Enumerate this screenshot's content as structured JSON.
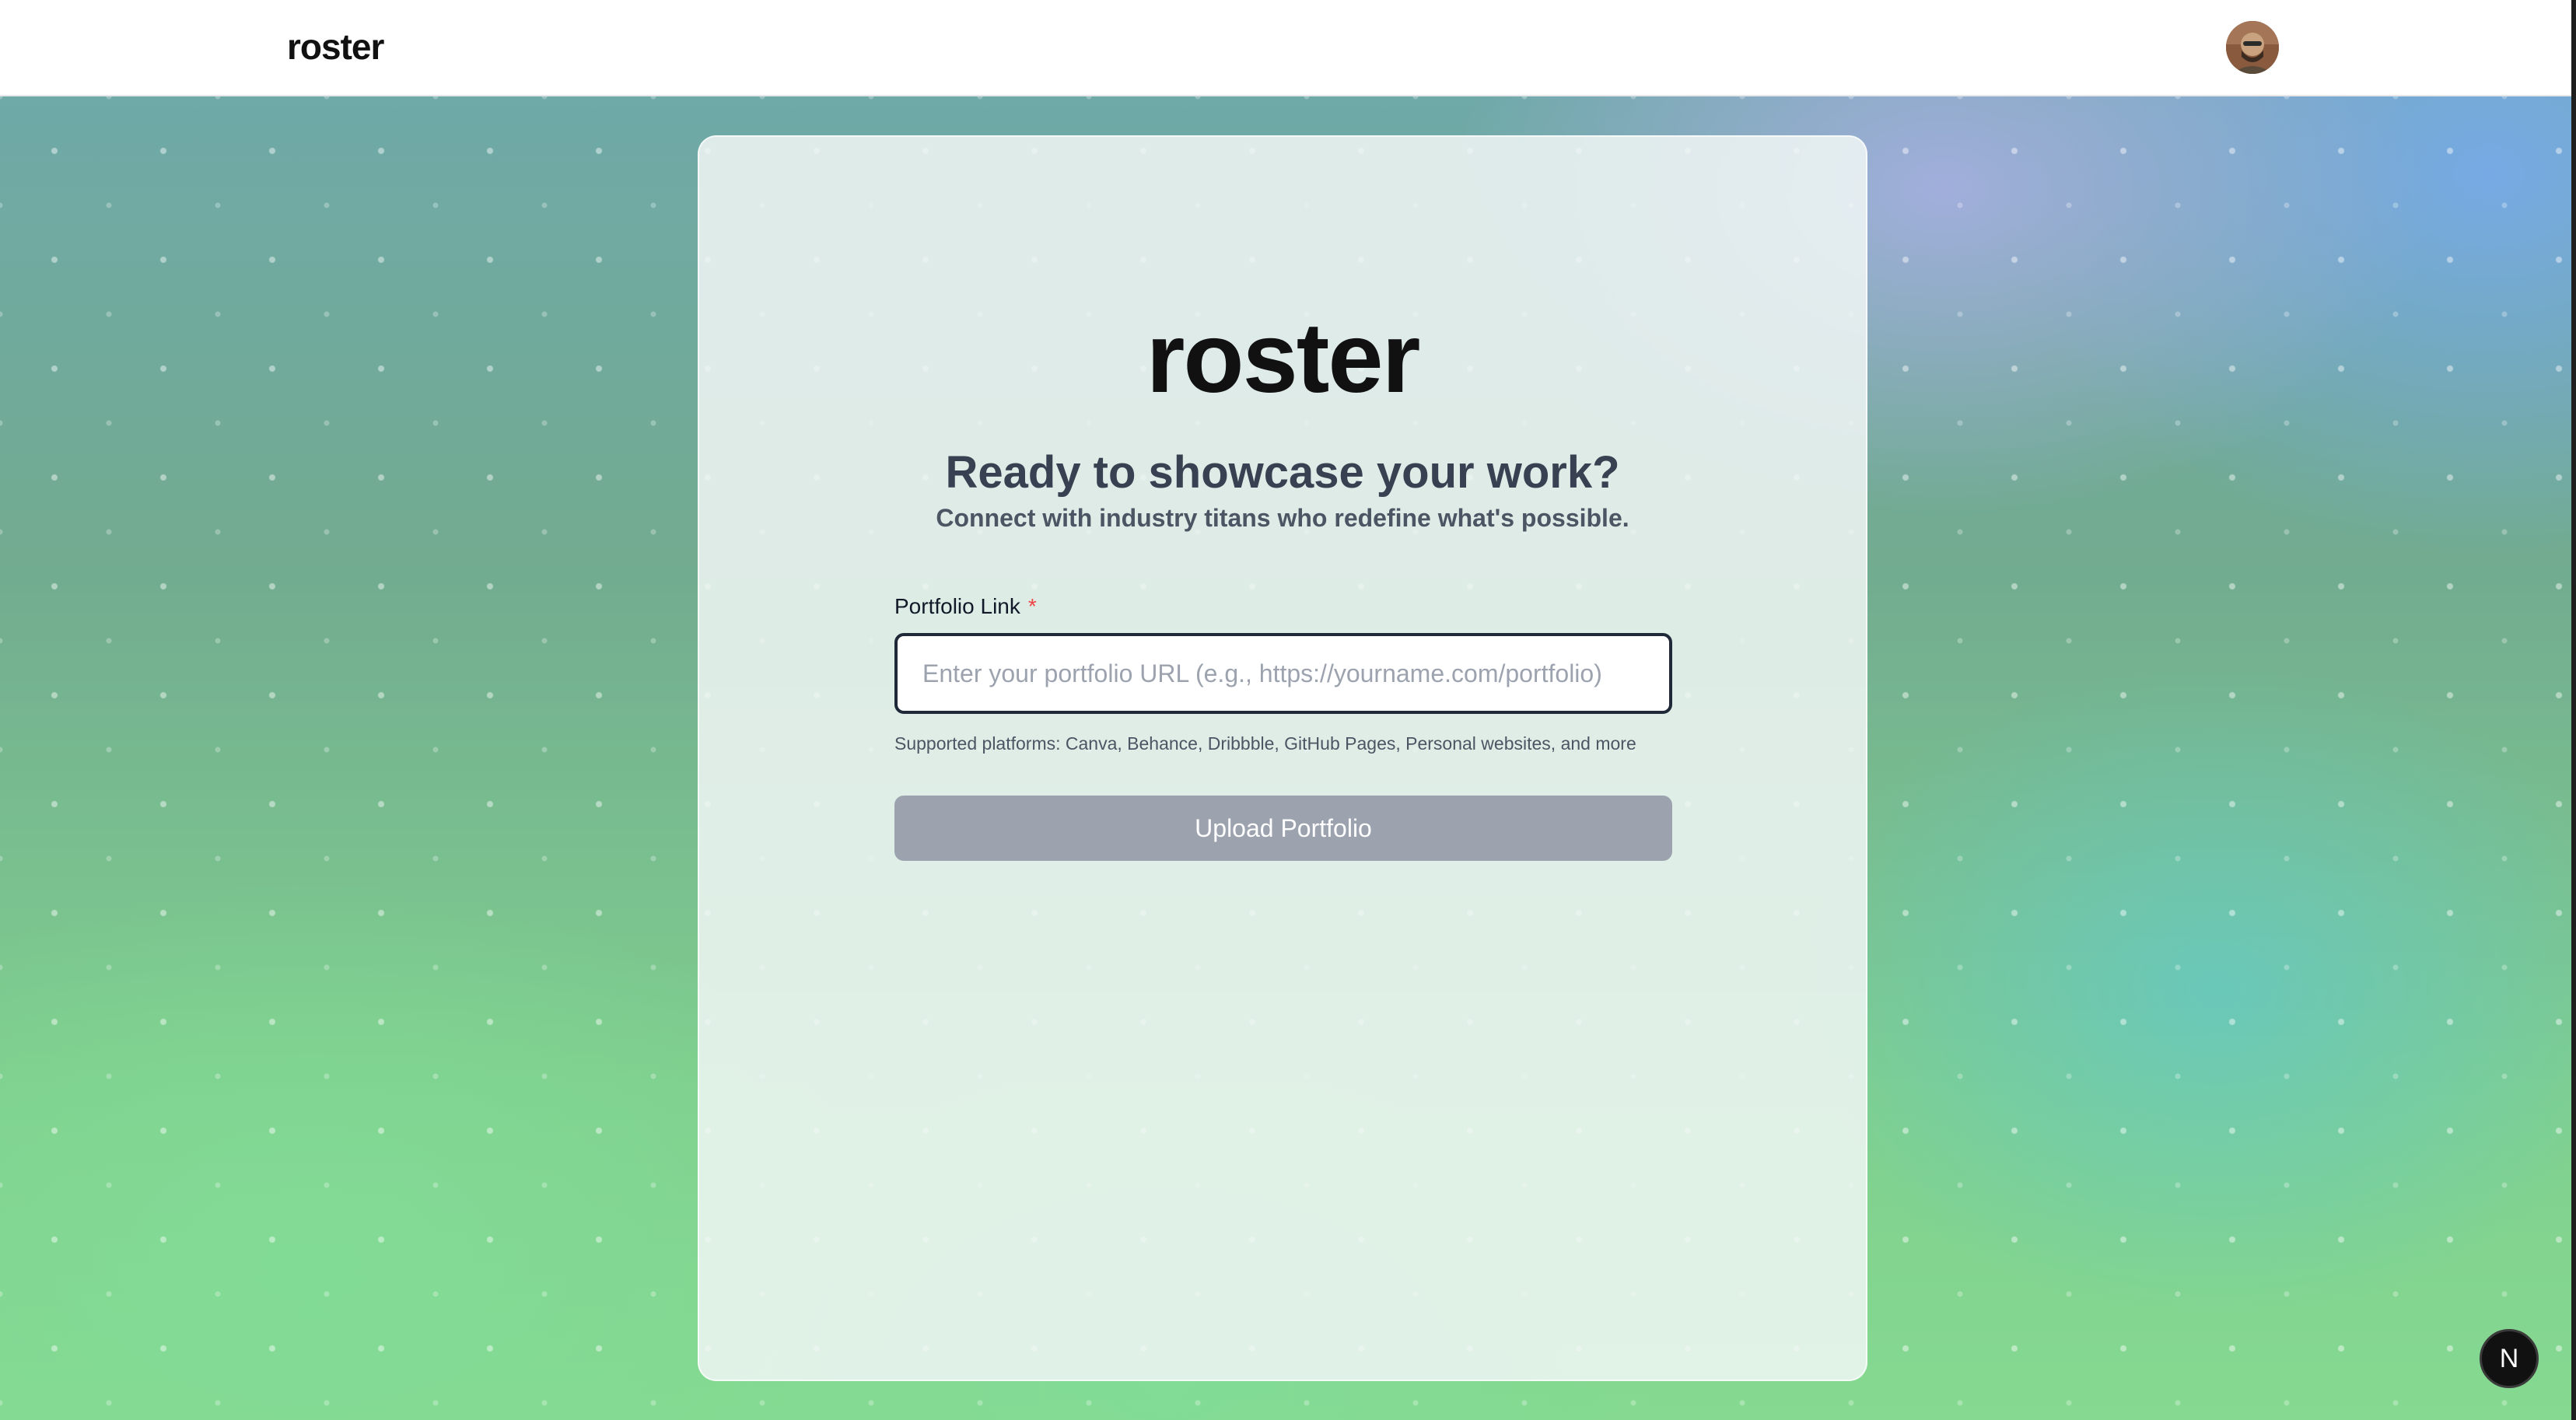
{
  "header": {
    "brand": "roster",
    "avatar_icon": "user-avatar-icon"
  },
  "card": {
    "logo": "roster",
    "headline": "Ready to showcase your work?",
    "subheadline": "Connect with industry titans who redefine what's possible.",
    "field_label": "Portfolio Link",
    "required_marker": "*",
    "input_value": "",
    "input_placeholder": "Enter your portfolio URL (e.g., https://yourname.com/portfolio)",
    "helper_text": "Supported platforms: Canva, Behance, Dribbble, GitHub Pages, Personal websites, and more",
    "submit_label": "Upload Portfolio"
  },
  "badge": {
    "label": "N",
    "icon": "nextjs-icon"
  },
  "colors": {
    "required": "#ef4444",
    "button_disabled": "#9ca3af",
    "heading": "#374151"
  }
}
